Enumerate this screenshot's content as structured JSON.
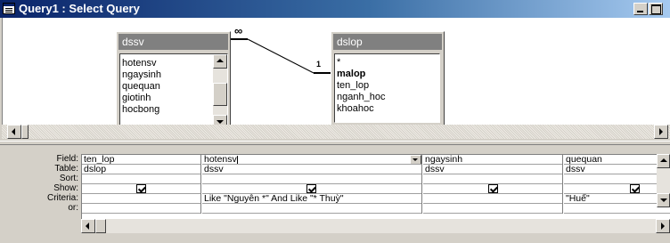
{
  "window": {
    "title": "Query1 : Select Query"
  },
  "tables": [
    {
      "name": "dssv",
      "fields": [
        "hotensv",
        "ngaysinh",
        "quequan",
        "giotinh",
        "hocbong"
      ]
    },
    {
      "name": "dslop",
      "fields": [
        "*",
        "malop",
        "ten_lop",
        "nganh_hoc",
        "khoahoc"
      ],
      "key_field": "malop"
    }
  ],
  "relationship": {
    "from_label": "∞",
    "to_label": "1"
  },
  "grid": {
    "row_labels": [
      "Field:",
      "Table:",
      "Sort:",
      "Show:",
      "Criteria:",
      "or:"
    ],
    "columns": [
      {
        "field": "ten_lop",
        "table": "dslop",
        "sort": "",
        "show": true,
        "criteria": "",
        "or": ""
      },
      {
        "field": "hotensv",
        "table": "dssv",
        "sort": "",
        "show": true,
        "criteria": "Like \"Nguyễn *\" And Like \"* Thuỳ\"",
        "or": ""
      },
      {
        "field": "ngaysinh",
        "table": "dssv",
        "sort": "",
        "show": true,
        "criteria": "",
        "or": ""
      },
      {
        "field": "quequan",
        "table": "dssv",
        "sort": "",
        "show": true,
        "criteria": "\"Huế\"",
        "or": ""
      }
    ]
  }
}
